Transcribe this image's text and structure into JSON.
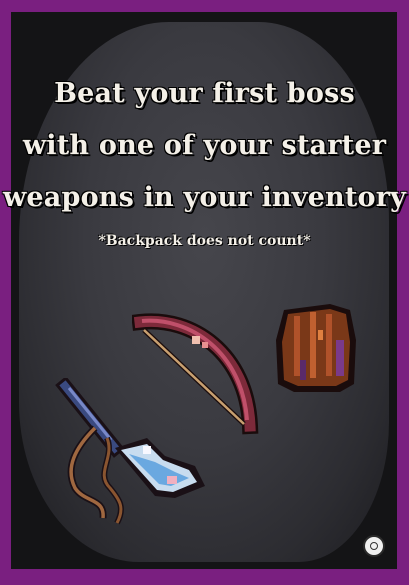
{
  "card": {
    "lines": [
      "Beat your first boss",
      "with one of your starter",
      "weapons in your inventory"
    ],
    "note": "*Backpack does not count*"
  },
  "colors": {
    "frame": "#7a1f80",
    "background": "#141416",
    "text": "#f4f0e8"
  },
  "icons": [
    "bow-icon",
    "pouch-icon",
    "axe-icon",
    "logo-icon"
  ]
}
